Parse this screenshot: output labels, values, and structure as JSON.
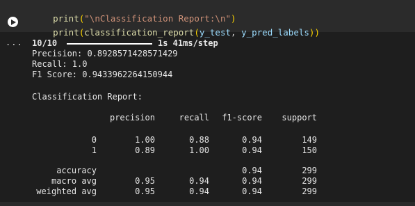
{
  "code": {
    "line1": {
      "fn": "print",
      "open": "(",
      "str": "\"\\nClassification Report:\\n\"",
      "close": ")"
    },
    "line2": {
      "fn": "print",
      "open": "(",
      "fn2": "classification_report",
      "open2": "(",
      "arg1": "y_test",
      "sep": ", ",
      "arg2": "y_pred_labels",
      "close2": ")",
      "close": ")"
    }
  },
  "output": {
    "icon": "...",
    "progress_label": "10/10",
    "progress_fraction": 1.0,
    "progress_time": "1s 41ms/step",
    "precision_line": "Precision: 0.8928571428571429",
    "recall_line": "Recall: 1.0",
    "f1_line": "F1 Score: 0.9433962264150944",
    "report_title": "Classification Report:",
    "table": {
      "headers": [
        "precision",
        "recall",
        "f1-score",
        "support"
      ],
      "rows": [
        {
          "label": "0",
          "precision": "1.00",
          "recall": "0.88",
          "f1": "0.94",
          "support": "149"
        },
        {
          "label": "1",
          "precision": "0.89",
          "recall": "1.00",
          "f1": "0.94",
          "support": "150"
        },
        {
          "label": "accuracy",
          "precision": "",
          "recall": "",
          "f1": "0.94",
          "support": "299"
        },
        {
          "label": "macro avg",
          "precision": "0.95",
          "recall": "0.94",
          "f1": "0.94",
          "support": "299"
        },
        {
          "label": "weighted avg",
          "precision": "0.95",
          "recall": "0.94",
          "f1": "0.94",
          "support": "299"
        }
      ]
    }
  }
}
